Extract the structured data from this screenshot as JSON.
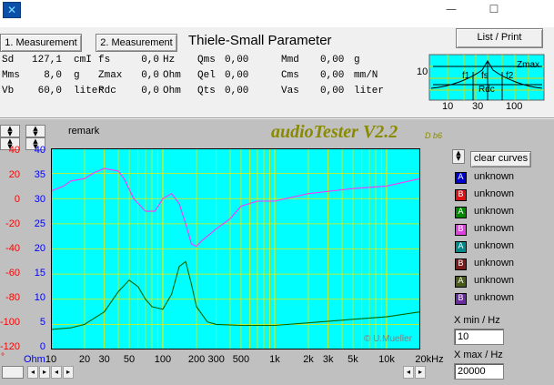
{
  "window": {
    "minimize": "—",
    "maximize": "☐"
  },
  "toolbar": {
    "measurement1": "1. Measurement",
    "measurement2": "2. Measurement",
    "title": "Thiele-Small Parameter",
    "list_print": "List / Print"
  },
  "params": {
    "col1": [
      {
        "label": "Sd",
        "value": "127,1",
        "unit": "cmI"
      },
      {
        "label": "Mms",
        "value": "8,0",
        "unit": "g"
      },
      {
        "label": "Vb",
        "value": "60,0",
        "unit": "liter"
      }
    ],
    "col2": [
      {
        "label": "fs",
        "value": "0,0",
        "unit": "Hz"
      },
      {
        "label": "Zmax",
        "value": "0,0",
        "unit": "Ohm"
      },
      {
        "label": "Rdc",
        "value": "0,0",
        "unit": "Ohm"
      }
    ],
    "col3": [
      {
        "label": "Qms",
        "value": "0,00"
      },
      {
        "label": "Qel",
        "value": "0,00"
      },
      {
        "label": "Qts",
        "value": "0,00"
      }
    ],
    "col4": [
      {
        "label": "Mmd",
        "value": "0,00",
        "unit": "g"
      },
      {
        "label": "Cms",
        "value": "0,00",
        "unit": "mm/N"
      },
      {
        "label": "Vas",
        "value": "0,00",
        "unit": "liter"
      }
    ]
  },
  "mini_graph": {
    "y_label": "10",
    "x_ticks": [
      "10",
      "30",
      "100"
    ],
    "labels": {
      "zmax": "Zmax",
      "f1": "f1",
      "fs": "fs",
      "f2": "f2",
      "rdc": "Rdc"
    }
  },
  "main": {
    "remark": "remark",
    "brand": "audioTester V2.2",
    "version": "D b6",
    "copyright": "© U.Mueller",
    "left_axis_red": [
      "40",
      "20",
      "0",
      "-20",
      "-40",
      "-60",
      "-80",
      "-100",
      "-120"
    ],
    "left_axis_blue": [
      "40",
      "35",
      "30",
      "25",
      "20",
      "15",
      "10",
      "5",
      "0"
    ],
    "ohm_label": "Ohm",
    "degree_label": "°",
    "x_ticks": [
      "10",
      "20",
      "30",
      "50",
      "100",
      "200",
      "300",
      "500",
      "1k",
      "2k",
      "3k",
      "5k",
      "10k",
      "20kHz"
    ],
    "clear_curves": "clear curves",
    "legend": [
      {
        "letter": "A",
        "color": "#0000cc",
        "text": "unknown"
      },
      {
        "letter": "B",
        "color": "#dd1111",
        "text": "unknown"
      },
      {
        "letter": "A",
        "color": "#008800",
        "text": "unknown"
      },
      {
        "letter": "B",
        "color": "#e040e0",
        "text": "unknown"
      },
      {
        "letter": "A",
        "color": "#008888",
        "text": "unknown"
      },
      {
        "letter": "B",
        "color": "#7a1a1a",
        "text": "unknown"
      },
      {
        "letter": "A",
        "color": "#4a5a1a",
        "text": "unknown"
      },
      {
        "letter": "B",
        "color": "#6a2aa0",
        "text": "unknown"
      }
    ],
    "xmin_label": "X min / Hz",
    "xmin_value": "10",
    "xmax_label": "X max / Hz",
    "xmax_value": "20000"
  },
  "chart_data": {
    "type": "line",
    "x_scale": "log",
    "xlim": [
      10,
      20000
    ],
    "y_axes": [
      {
        "side": "left-outer",
        "color": "#ff0000",
        "ylim": [
          -120,
          40
        ]
      },
      {
        "side": "left-inner",
        "color": "#0000ff",
        "ylim": [
          0,
          40
        ],
        "unit": "Ohm"
      }
    ],
    "grid": true,
    "background": "#00ffff",
    "series": [
      {
        "color": "#ff33ff",
        "x": [
          10,
          13,
          15,
          20,
          25,
          30,
          40,
          45,
          55,
          70,
          85,
          100,
          120,
          140,
          160,
          180,
          200,
          220,
          300,
          400,
          500,
          700,
          1000,
          2000,
          5000,
          10000,
          20000
        ],
        "y": [
          31.5,
          32.5,
          33.5,
          34,
          35.3,
          36,
          35.5,
          34,
          30,
          27.5,
          27.5,
          30,
          31,
          29,
          25,
          21,
          20.5,
          21.5,
          24,
          26,
          28.5,
          29.5,
          29.5,
          31,
          32,
          32.5,
          34
        ]
      },
      {
        "color": "#006600",
        "x": [
          10,
          15,
          20,
          30,
          40,
          50,
          60,
          70,
          80,
          100,
          120,
          140,
          160,
          180,
          200,
          250,
          300,
          500,
          1000,
          2000,
          5000,
          10000,
          20000
        ],
        "y": [
          4,
          4.3,
          5,
          7.5,
          11.5,
          13.8,
          12.5,
          10,
          8.5,
          8,
          11,
          16.5,
          17.5,
          13,
          8.5,
          5.5,
          5,
          4.8,
          4.8,
          5.3,
          6,
          6.5,
          7.5
        ]
      }
    ]
  }
}
